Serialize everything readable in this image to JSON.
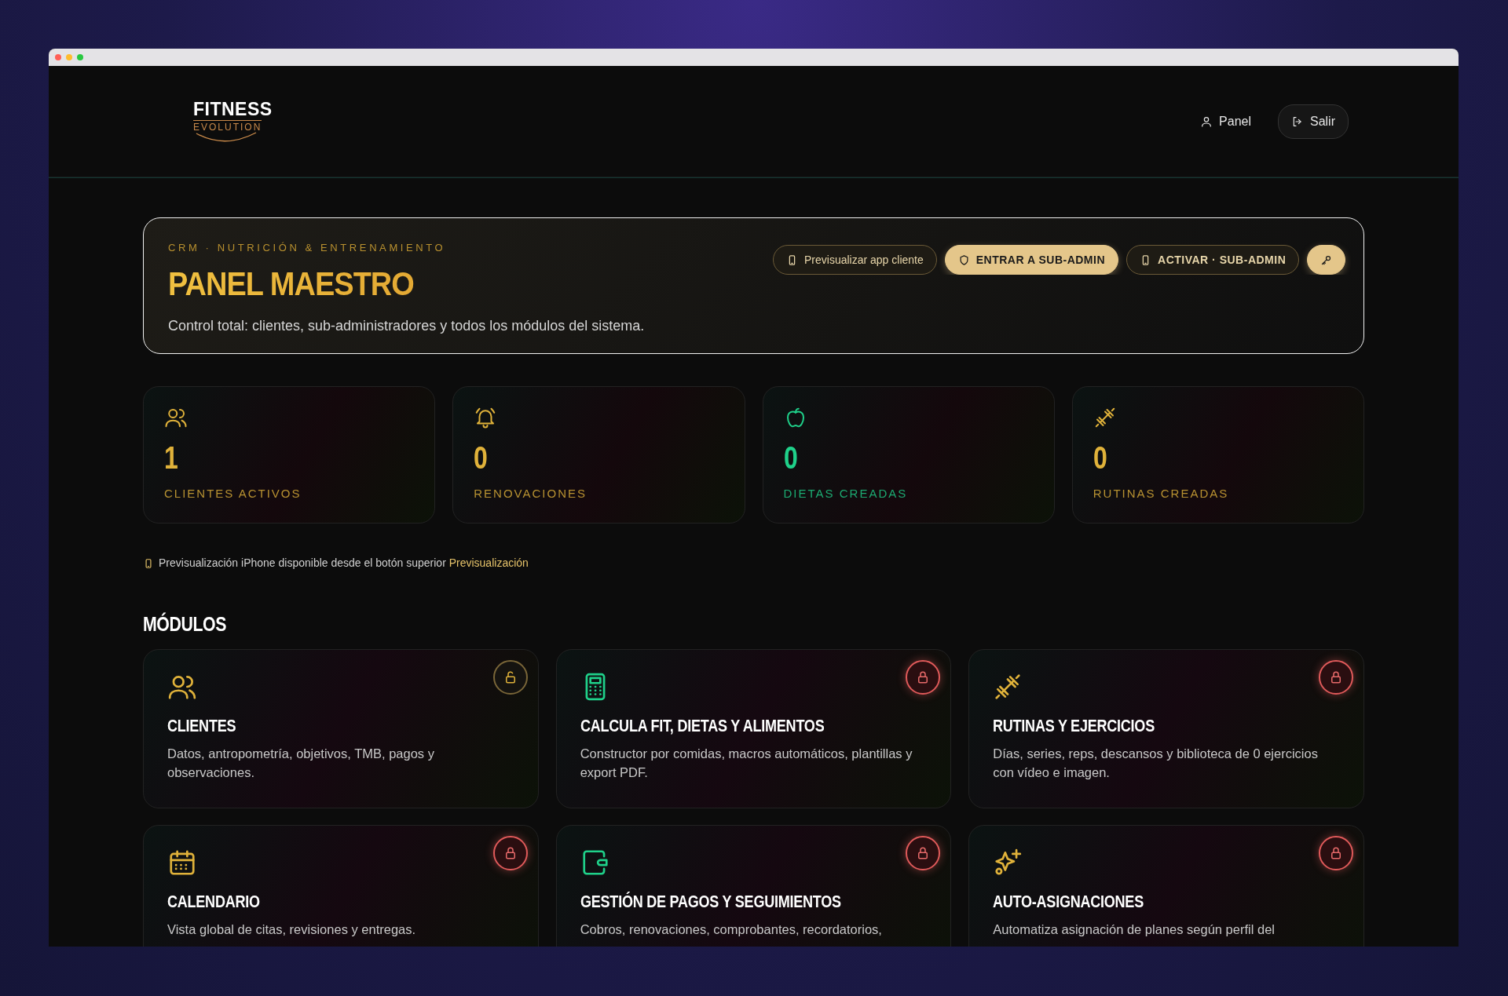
{
  "header": {
    "logo": {
      "title": "FITNESS",
      "subtitle": "EVOLUTION"
    },
    "nav": [
      {
        "kind": "link",
        "label": "Panel"
      },
      {
        "kind": "button",
        "label": "Salir"
      }
    ]
  },
  "hero": {
    "eyebrow": "CRM · NUTRICIÓN & ENTRENAMIENTO",
    "title": "PANEL MAESTRO",
    "subtitle": "Control total: clientes, sub-administradores y todos los módulos del sistema.",
    "buttons": [
      {
        "kind": "outline",
        "label": "Previsualizar app cliente"
      },
      {
        "kind": "filled",
        "label": "ENTRAR A SUB-ADMIN"
      },
      {
        "kind": "outline",
        "label": "ACTIVAR · SUB-ADMIN"
      },
      {
        "kind": "filled"
      }
    ]
  },
  "stats": [
    {
      "kind": "users",
      "value": "1",
      "label": "CLIENTES ACTIVOS",
      "color": "#e0b23a"
    },
    {
      "kind": "bell",
      "value": "0",
      "label": "RENOVACIONES",
      "color": "#e0b23a"
    },
    {
      "kind": "apple",
      "value": "0",
      "label": "DIETAS CREADAS",
      "color": "#1fd18a"
    },
    {
      "kind": "dumbbell",
      "value": "0",
      "label": "RUTINAS CREADAS",
      "color": "#e0b23a"
    }
  ],
  "note": {
    "text": "Previsualización iPhone disponible desde el botón superior",
    "link": "Previsualización"
  },
  "modules_title": "MÓDULOS",
  "modules": [
    {
      "kind": "users",
      "color": "#e0b23a",
      "locked": false,
      "title": "CLIENTES",
      "description": "Datos, antropometría, objetivos, TMB, pagos y observaciones."
    },
    {
      "kind": "calculator",
      "color": "#1fd18a",
      "locked": true,
      "title": "CALCULA FIT, DIETAS Y ALIMENTOS",
      "description": "Constructor por comidas, macros automáticos, plantillas y export PDF."
    },
    {
      "kind": "dumbbell",
      "color": "#e0b23a",
      "locked": true,
      "title": "RUTINAS Y EJERCICIOS",
      "description": "Días, series, reps, descansos y biblioteca de 0 ejercicios con vídeo e imagen."
    },
    {
      "kind": "calendar",
      "color": "#e0b23a",
      "locked": true,
      "title": "CALENDARIO",
      "description": "Vista global de citas, revisiones y entregas."
    },
    {
      "kind": "wallet",
      "color": "#1fd18a",
      "locked": true,
      "title": "GESTIÓN DE PAGOS Y SEGUIMIENTOS",
      "description": "Cobros, renovaciones, comprobantes, recordatorios,"
    },
    {
      "kind": "sparkles",
      "color": "#e0b23a",
      "locked": true,
      "title": "AUTO-ASIGNACIONES",
      "description": "Automatiza asignación de planes según perfil del"
    }
  ]
}
